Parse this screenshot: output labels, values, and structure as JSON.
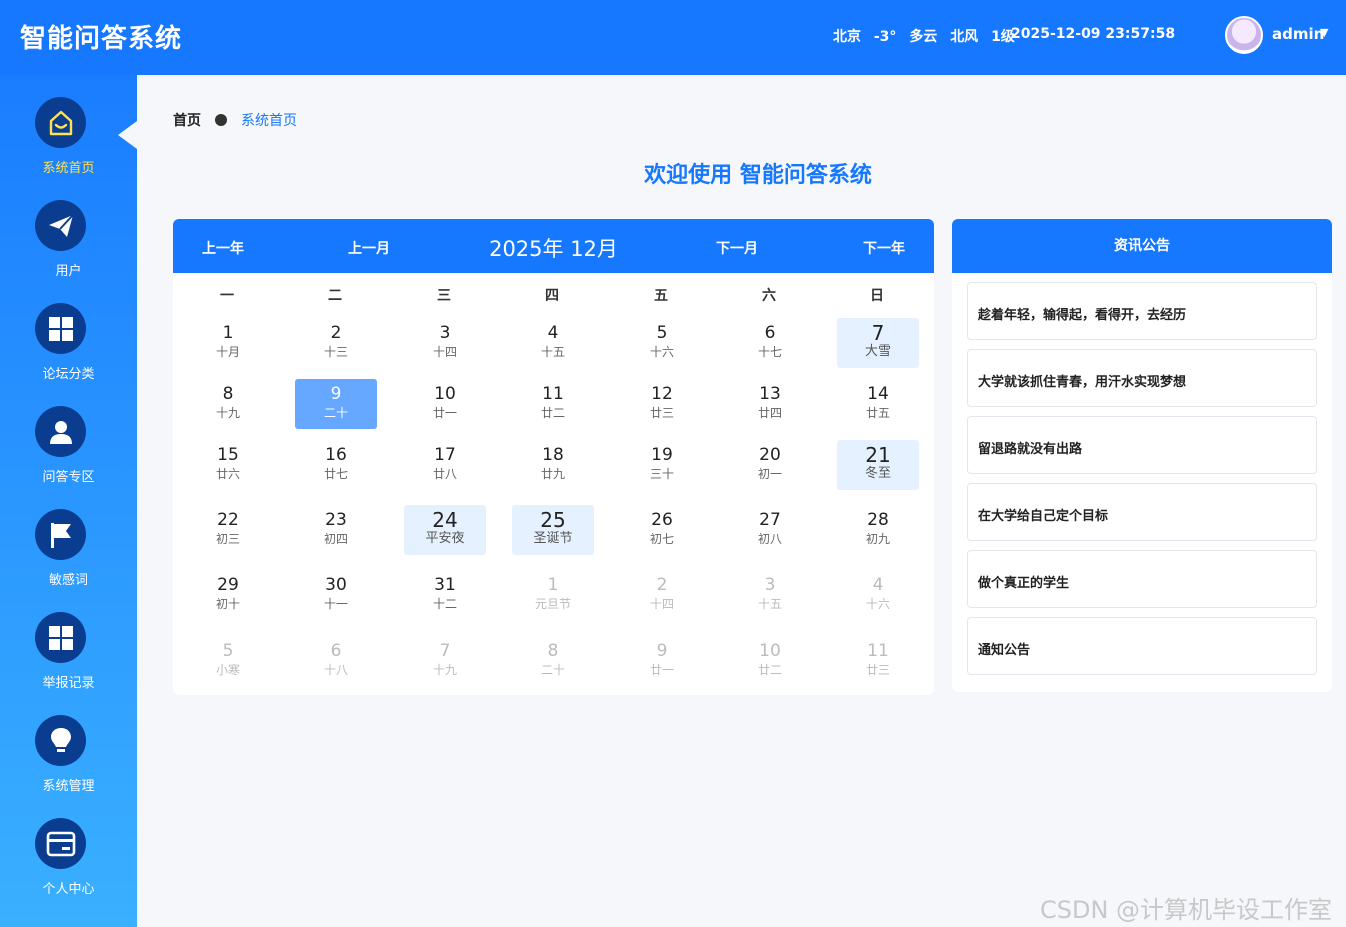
{
  "app": {
    "title": "智能问答系统"
  },
  "header": {
    "weather": {
      "city": "北京",
      "temp": "-3°",
      "cond": "多云",
      "wind": "北风",
      "level": "1级"
    },
    "datetime": "2025-12-09 23:57:58",
    "username": "admin"
  },
  "sidebar": {
    "items": [
      {
        "label": "系统首页",
        "icon": "home-icon"
      },
      {
        "label": "用户",
        "icon": "paper-plane-icon"
      },
      {
        "label": "论坛分类",
        "icon": "grid-icon"
      },
      {
        "label": "问答专区",
        "icon": "user-icon"
      },
      {
        "label": "敏感词",
        "icon": "flag-icon"
      },
      {
        "label": "举报记录",
        "icon": "grid-icon"
      },
      {
        "label": "系统管理",
        "icon": "lightbulb-icon"
      },
      {
        "label": "个人中心",
        "icon": "wallet-icon"
      }
    ]
  },
  "breadcrumb": {
    "home": "首页",
    "current": "系统首页"
  },
  "welcome": "欢迎使用 智能问答系统",
  "calendar": {
    "prev_year": "上一年",
    "prev_month": "上一月",
    "month_title": "2025年 12月",
    "next_month": "下一月",
    "next_year": "下一年",
    "weekdays": [
      "一",
      "二",
      "三",
      "四",
      "五",
      "六",
      "日"
    ],
    "weeks": [
      [
        {
          "d": "1",
          "l": "十月"
        },
        {
          "d": "2",
          "l": "十三"
        },
        {
          "d": "3",
          "l": "十四"
        },
        {
          "d": "4",
          "l": "十五"
        },
        {
          "d": "5",
          "l": "十六"
        },
        {
          "d": "6",
          "l": "十七"
        },
        {
          "d": "7",
          "l": "大雪",
          "festival": true
        }
      ],
      [
        {
          "d": "8",
          "l": "十九"
        },
        {
          "d": "9",
          "l": "二十",
          "today": true
        },
        {
          "d": "10",
          "l": "廿一"
        },
        {
          "d": "11",
          "l": "廿二"
        },
        {
          "d": "12",
          "l": "廿三"
        },
        {
          "d": "13",
          "l": "廿四"
        },
        {
          "d": "14",
          "l": "廿五"
        }
      ],
      [
        {
          "d": "15",
          "l": "廿六"
        },
        {
          "d": "16",
          "l": "廿七"
        },
        {
          "d": "17",
          "l": "廿八"
        },
        {
          "d": "18",
          "l": "廿九"
        },
        {
          "d": "19",
          "l": "三十"
        },
        {
          "d": "20",
          "l": "初一"
        },
        {
          "d": "21",
          "l": "冬至",
          "festival": true
        }
      ],
      [
        {
          "d": "22",
          "l": "初三"
        },
        {
          "d": "23",
          "l": "初四"
        },
        {
          "d": "24",
          "l": "平安夜",
          "festival": true
        },
        {
          "d": "25",
          "l": "圣诞节",
          "festival": true
        },
        {
          "d": "26",
          "l": "初七"
        },
        {
          "d": "27",
          "l": "初八"
        },
        {
          "d": "28",
          "l": "初九"
        }
      ],
      [
        {
          "d": "29",
          "l": "初十"
        },
        {
          "d": "30",
          "l": "十一"
        },
        {
          "d": "31",
          "l": "十二"
        },
        {
          "d": "1",
          "l": "元旦节",
          "other": true
        },
        {
          "d": "2",
          "l": "十四",
          "other": true
        },
        {
          "d": "3",
          "l": "十五",
          "other": true
        },
        {
          "d": "4",
          "l": "十六",
          "other": true
        }
      ],
      [
        {
          "d": "5",
          "l": "小寒",
          "other": true
        },
        {
          "d": "6",
          "l": "十八",
          "other": true
        },
        {
          "d": "7",
          "l": "十九",
          "other": true
        },
        {
          "d": "8",
          "l": "二十",
          "other": true
        },
        {
          "d": "9",
          "l": "廿一",
          "other": true
        },
        {
          "d": "10",
          "l": "廿二",
          "other": true
        },
        {
          "d": "11",
          "l": "廿三",
          "other": true
        }
      ]
    ]
  },
  "news": {
    "title": "资讯公告",
    "items": [
      "趁着年轻，输得起，看得开，去经历",
      "大学就该抓住青春，用汗水实现梦想",
      "留退路就没有出路",
      "在大学给自己定个目标",
      "做个真正的学生",
      "通知公告"
    ]
  },
  "watermark": "CSDN @计算机毕设工作室"
}
